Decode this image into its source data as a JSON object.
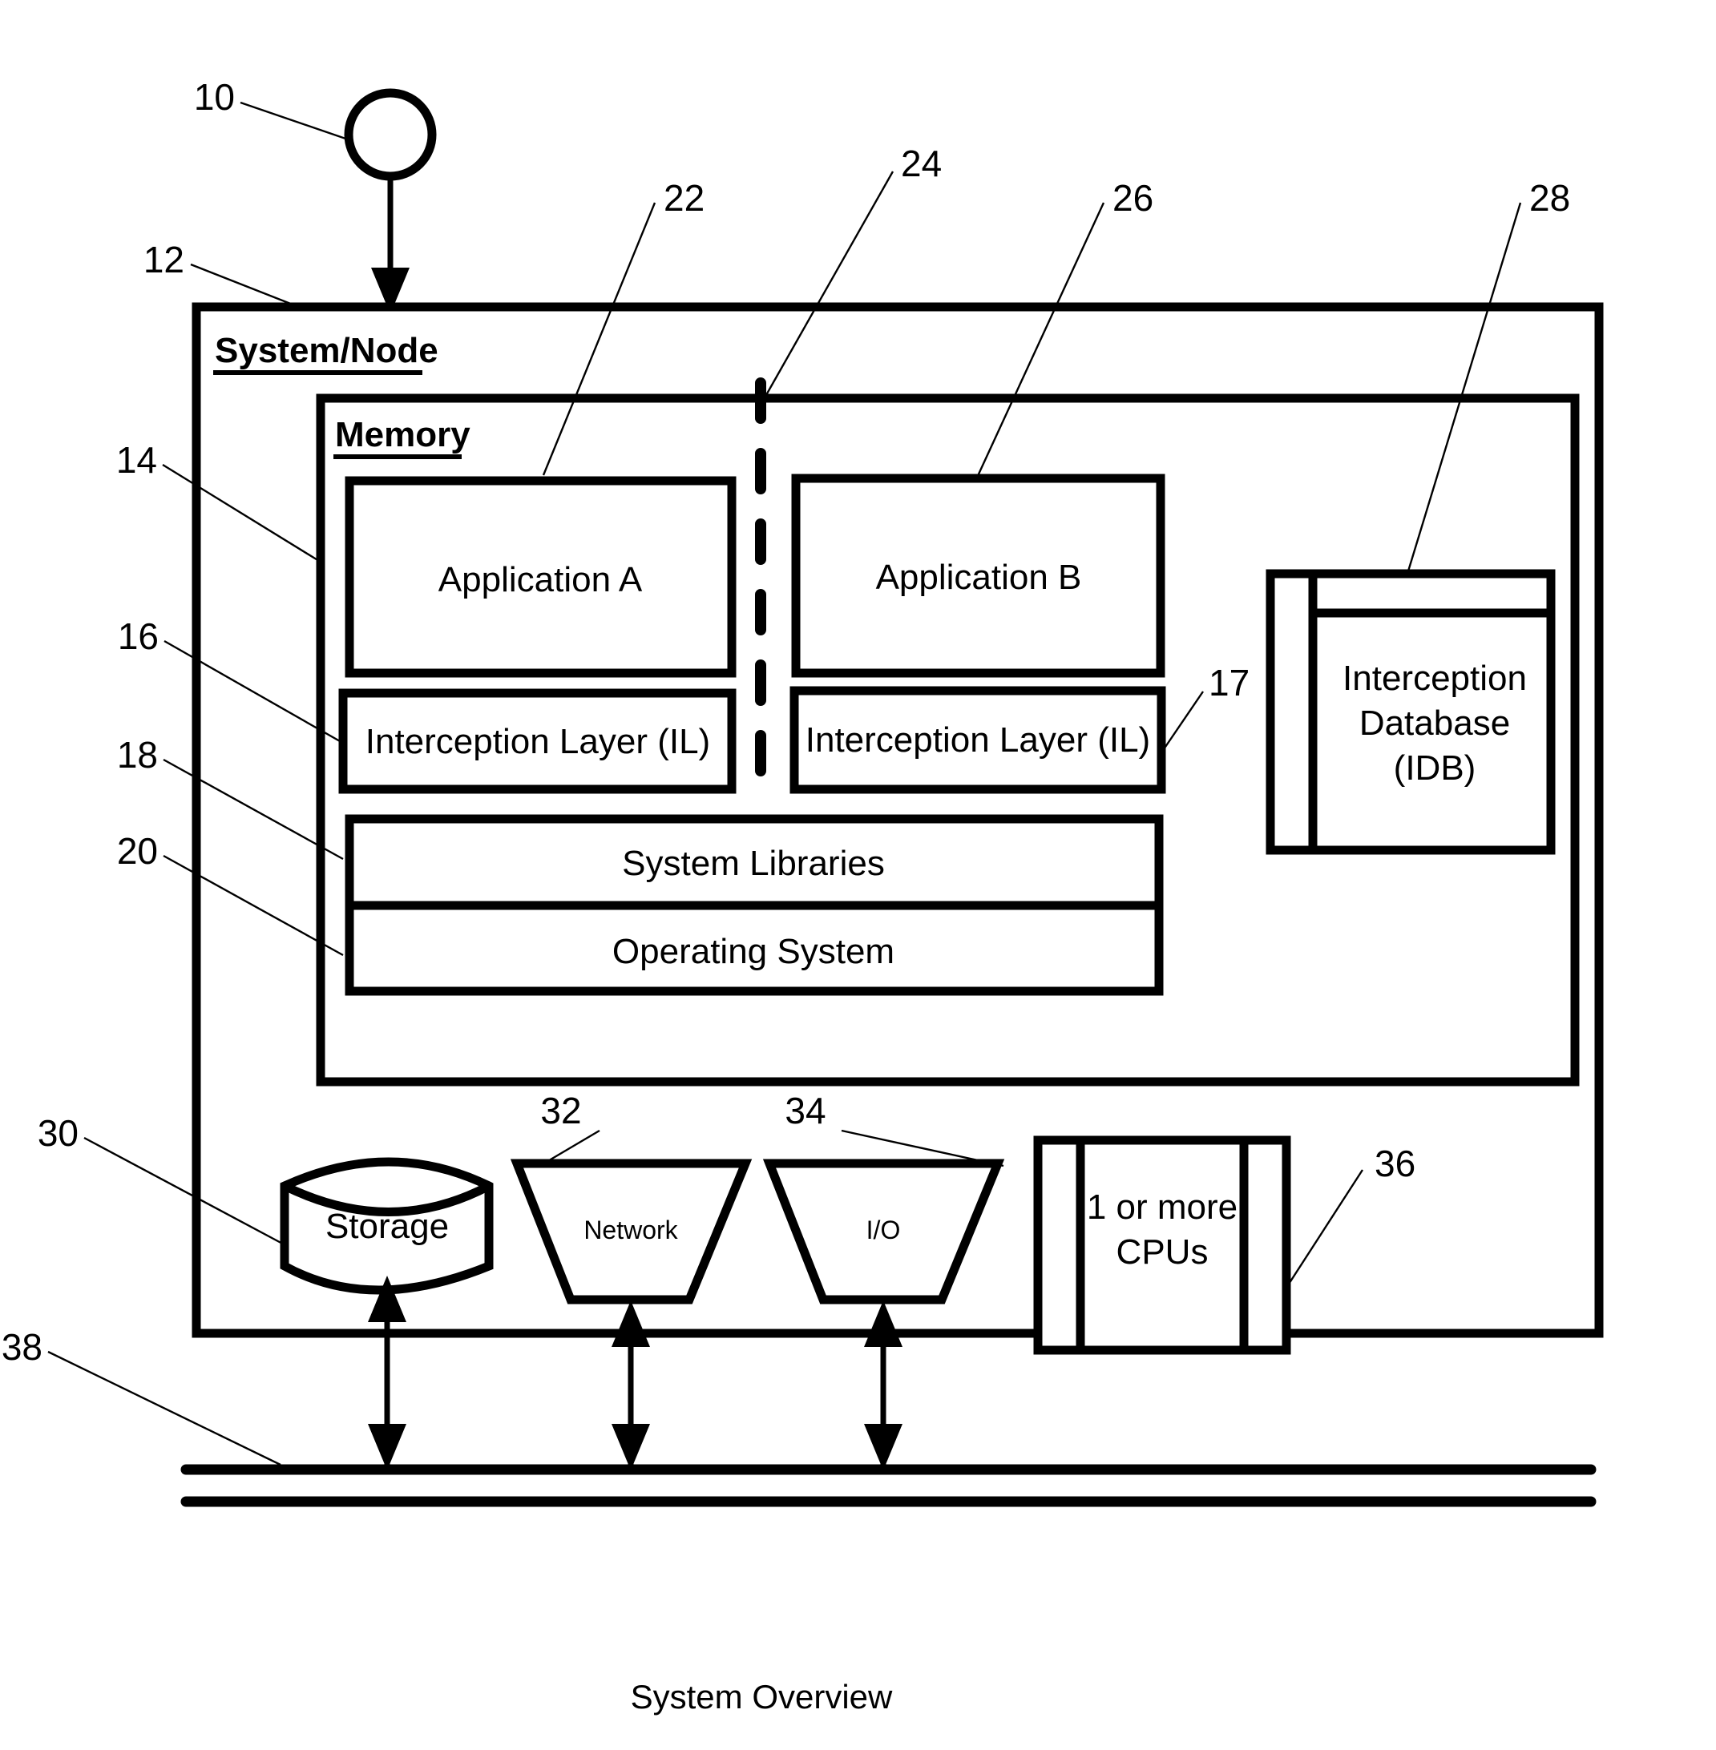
{
  "figure": {
    "caption": "System Overview",
    "colors": {
      "ink": "#000000",
      "paper": "#ffffff"
    }
  },
  "reference_numerals": {
    "n10": "10",
    "n12": "12",
    "n14": "14",
    "n16": "16",
    "n17": "17",
    "n18": "18",
    "n20": "20",
    "n22": "22",
    "n24": "24",
    "n26": "26",
    "n28": "28",
    "n30": "30",
    "n32": "32",
    "n34": "34",
    "n36": "36",
    "n38": "38"
  },
  "system_node": {
    "title": "System/Node"
  },
  "memory": {
    "title": "Memory",
    "application_a": "Application A",
    "application_b": "Application B",
    "interception_layer_a": "Interception Layer (IL)",
    "interception_layer_b": "Interception Layer (IL)",
    "interception_database": {
      "line1": "Interception",
      "line2": "Database",
      "line3": "(IDB)"
    },
    "system_libraries": "System Libraries",
    "operating_system": "Operating System"
  },
  "hardware": {
    "storage": "Storage",
    "network": "Network",
    "io": "I/O",
    "cpus": {
      "line1": "1 or more",
      "line2": "CPUs"
    }
  }
}
